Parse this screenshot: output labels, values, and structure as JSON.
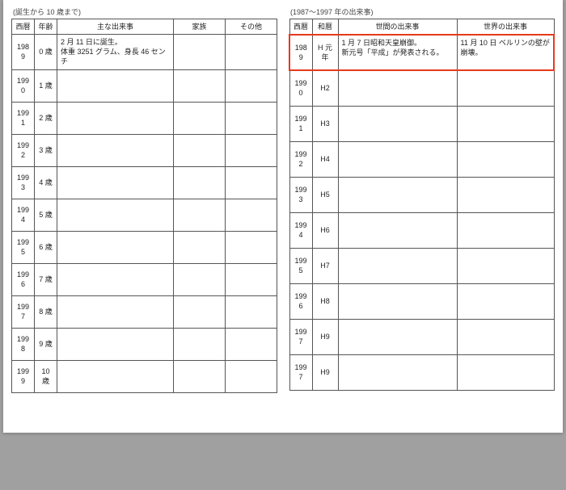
{
  "left": {
    "caption": "(誕生から 10 歳まで)",
    "headers": {
      "year": "西暦",
      "age": "年齢",
      "events": "主な出来事",
      "family": "家族",
      "other": "その他"
    },
    "rows": [
      {
        "year": "1989",
        "age": "0 歳",
        "events": "2 月 11 日に誕生。\n体重 3251 グラム、身長 46 センチ",
        "family": "",
        "other": ""
      },
      {
        "year": "1990",
        "age": "1 歳",
        "events": "",
        "family": "",
        "other": ""
      },
      {
        "year": "1991",
        "age": "2 歳",
        "events": "",
        "family": "",
        "other": ""
      },
      {
        "year": "1992",
        "age": "3 歳",
        "events": "",
        "family": "",
        "other": ""
      },
      {
        "year": "1993",
        "age": "4 歳",
        "events": "",
        "family": "",
        "other": ""
      },
      {
        "year": "1994",
        "age": "5 歳",
        "events": "",
        "family": "",
        "other": ""
      },
      {
        "year": "1995",
        "age": "6 歳",
        "events": "",
        "family": "",
        "other": ""
      },
      {
        "year": "1996",
        "age": "7 歳",
        "events": "",
        "family": "",
        "other": ""
      },
      {
        "year": "1997",
        "age": "8 歳",
        "events": "",
        "family": "",
        "other": ""
      },
      {
        "year": "1998",
        "age": "9 歳",
        "events": "",
        "family": "",
        "other": ""
      },
      {
        "year": "1999",
        "age": "10 歳",
        "events": "",
        "family": "",
        "other": ""
      }
    ]
  },
  "right": {
    "caption": "(1987〜1997 年の出来事)",
    "headers": {
      "year": "西暦",
      "era": "和暦",
      "society": "世間の出来事",
      "world": "世界の出来事"
    },
    "rows": [
      {
        "year": "1989",
        "era": "H 元年",
        "society": "1 月 7 日昭和天皇崩御。\n新元号「平成」が発表される。",
        "world": "11 月 10 日 ベルリンの壁が崩壊。",
        "highlight": true
      },
      {
        "year": "1990",
        "era": "H2",
        "society": "",
        "world": ""
      },
      {
        "year": "1991",
        "era": "H3",
        "society": "",
        "world": ""
      },
      {
        "year": "1992",
        "era": "H4",
        "society": "",
        "world": ""
      },
      {
        "year": "1993",
        "era": "H5",
        "society": "",
        "world": ""
      },
      {
        "year": "1994",
        "era": "H6",
        "society": "",
        "world": ""
      },
      {
        "year": "1995",
        "era": "H7",
        "society": "",
        "world": ""
      },
      {
        "year": "1996",
        "era": "H8",
        "society": "",
        "world": ""
      },
      {
        "year": "1997",
        "era": "H9",
        "society": "",
        "world": ""
      },
      {
        "year": "1997",
        "era": "H9",
        "society": "",
        "world": ""
      }
    ]
  }
}
